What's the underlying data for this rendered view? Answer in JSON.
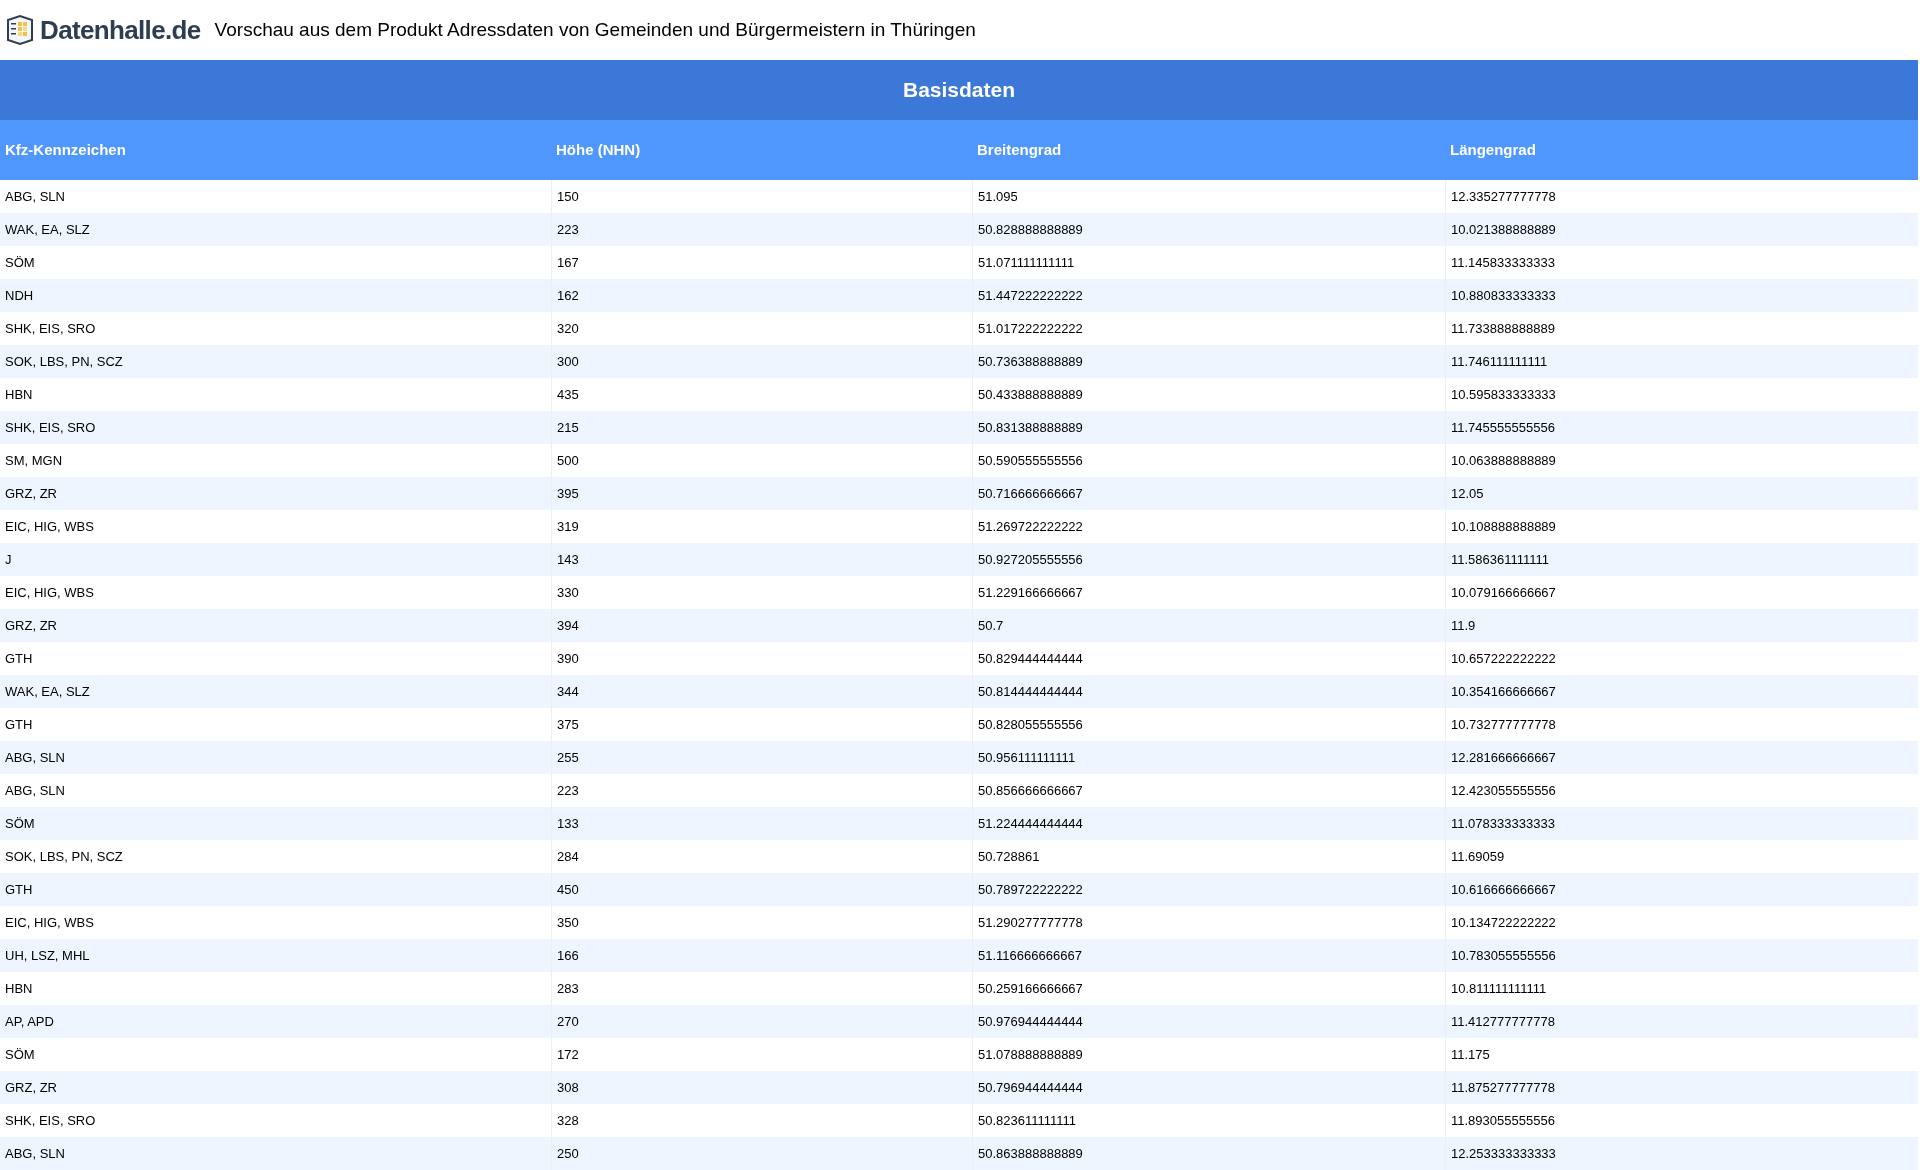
{
  "header": {
    "logo": "Datenhalle.de",
    "title": "Vorschau aus dem Produkt Adressdaten von Gemeinden und Bürgermeistern in Thüringen"
  },
  "table": {
    "caption": "Basisdaten",
    "columns": [
      "Kfz-Kennzeichen",
      "Höhe (NHN)",
      "Breitengrad",
      "Längengrad"
    ],
    "rows": [
      [
        "ABG, SLN",
        "150",
        "51.095",
        "12.335277777778"
      ],
      [
        "WAK, EA, SLZ",
        "223",
        "50.828888888889",
        "10.021388888889"
      ],
      [
        "SÖM",
        "167",
        "51.071111111111",
        "11.145833333333"
      ],
      [
        "NDH",
        "162",
        "51.447222222222",
        "10.880833333333"
      ],
      [
        "SHK, EIS, SRO",
        "320",
        "51.017222222222",
        "11.733888888889"
      ],
      [
        "SOK, LBS, PN, SCZ",
        "300",
        "50.736388888889",
        "11.746111111111"
      ],
      [
        "HBN",
        "435",
        "50.433888888889",
        "10.595833333333"
      ],
      [
        "SHK, EIS, SRO",
        "215",
        "50.831388888889",
        "11.745555555556"
      ],
      [
        "SM, MGN",
        "500",
        "50.590555555556",
        "10.063888888889"
      ],
      [
        "GRZ, ZR",
        "395",
        "50.716666666667",
        "12.05"
      ],
      [
        "EIC, HIG, WBS",
        "319",
        "51.269722222222",
        "10.108888888889"
      ],
      [
        "J",
        "143",
        "50.927205555556",
        "11.586361111111"
      ],
      [
        "EIC, HIG, WBS",
        "330",
        "51.229166666667",
        "10.079166666667"
      ],
      [
        "GRZ, ZR",
        "394",
        "50.7",
        "11.9"
      ],
      [
        "GTH",
        "390",
        "50.829444444444",
        "10.657222222222"
      ],
      [
        "WAK, EA, SLZ",
        "344",
        "50.814444444444",
        "10.354166666667"
      ],
      [
        "GTH",
        "375",
        "50.828055555556",
        "10.732777777778"
      ],
      [
        "ABG, SLN",
        "255",
        "50.956111111111",
        "12.281666666667"
      ],
      [
        "ABG, SLN",
        "223",
        "50.856666666667",
        "12.423055555556"
      ],
      [
        "SÖM",
        "133",
        "51.224444444444",
        "11.078333333333"
      ],
      [
        "SOK, LBS, PN, SCZ",
        "284",
        "50.728861",
        "11.69059"
      ],
      [
        "GTH",
        "450",
        "50.789722222222",
        "10.616666666667"
      ],
      [
        "EIC, HIG, WBS",
        "350",
        "51.290277777778",
        "10.134722222222"
      ],
      [
        "UH, LSZ, MHL",
        "166",
        "51.116666666667",
        "10.783055555556"
      ],
      [
        "HBN",
        "283",
        "50.259166666667",
        "10.811111111111"
      ],
      [
        "AP, APD",
        "270",
        "50.976944444444",
        "11.412777777778"
      ],
      [
        "SÖM",
        "172",
        "51.078888888889",
        "11.175"
      ],
      [
        "GRZ, ZR",
        "308",
        "50.796944444444",
        "11.875277777778"
      ],
      [
        "SHK, EIS, SRO",
        "328",
        "50.823611111111",
        "11.893055555556"
      ],
      [
        "ABG, SLN",
        "250",
        "50.863888888889",
        "12.253333333333"
      ]
    ]
  }
}
